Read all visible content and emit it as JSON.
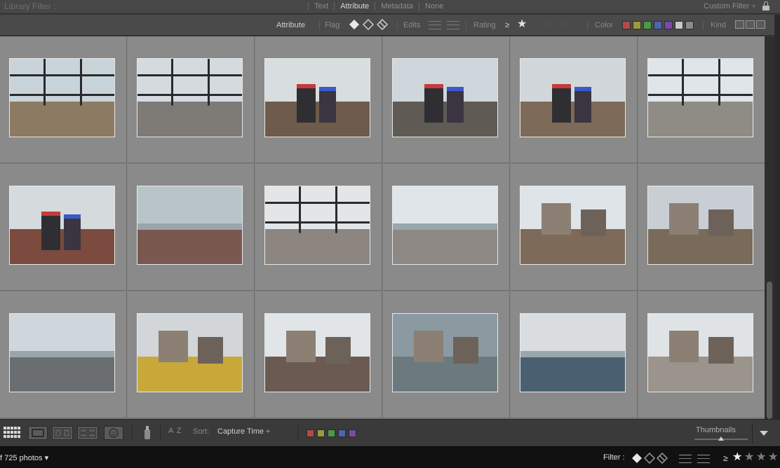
{
  "library_filter": {
    "title": "Library Filter :",
    "tabs": [
      {
        "label": "Text",
        "active": false
      },
      {
        "label": "Attribute",
        "active": true
      },
      {
        "label": "Metadata",
        "active": false
      },
      {
        "label": "None",
        "active": false
      }
    ],
    "custom_filter": "Custom Filter ÷",
    "lock_icon": "lock-icon"
  },
  "attribute_bar": {
    "attribute_label": "Attribute",
    "flag_label": "Flag",
    "edits_label": "Edits",
    "rating_label": "Rating",
    "rating_operator": "≥",
    "rating_value": 1,
    "color_label": "Color",
    "kind_label": "Kind",
    "star_glyph": "★",
    "color_swatches": [
      "#b34a4a",
      "#9c9a3a",
      "#4a9a4a",
      "#4a66b0",
      "#7a4aa8",
      "#c8c8c8",
      "#8a8a8a"
    ]
  },
  "toolbar": {
    "sort_label": "Sort:",
    "sort_value": "Capture Time ÷",
    "sort_icon_text": "A Z",
    "thumbnails_label": "Thumbnails",
    "thumbnail_size": 0.5,
    "color_swatches": [
      "#b34a4a",
      "#9c9a3a",
      "#4a9a4a",
      "#4a66b0",
      "#7a4aa8"
    ]
  },
  "statusbar": {
    "photo_count": "f 725 photos ▾",
    "filter_label": "Filter :",
    "rating_operator": "≥",
    "star_glyph": "★"
  }
}
